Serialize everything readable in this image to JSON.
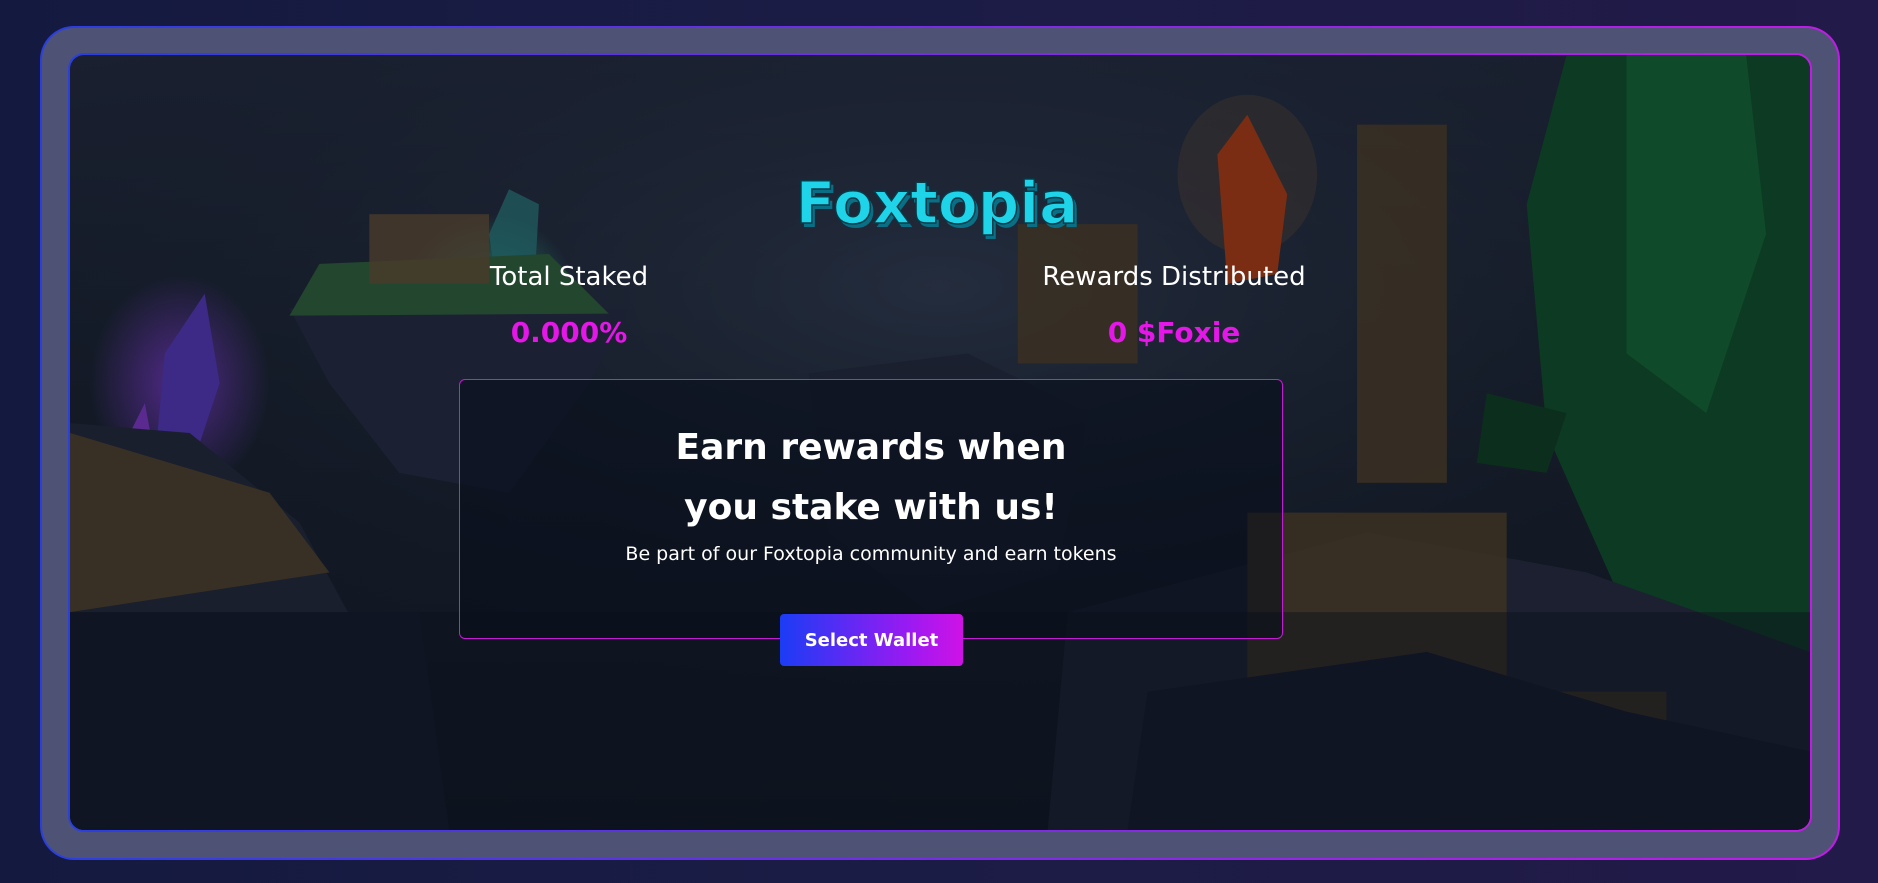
{
  "brand": {
    "name": "Foxtopia",
    "logo_color": "#1fd4e8",
    "accent": "#e416e8"
  },
  "stats": {
    "total_staked": {
      "label": "Total Staked",
      "value": "0.000%"
    },
    "rewards_distributed": {
      "label": "Rewards Distributed",
      "value": "0 $Foxie"
    }
  },
  "card": {
    "heading": "Earn rewards when you stake with us!",
    "subtitle": "Be part of our Foxtopia community and earn tokens"
  },
  "actions": {
    "select_wallet_label": "Select Wallet"
  }
}
